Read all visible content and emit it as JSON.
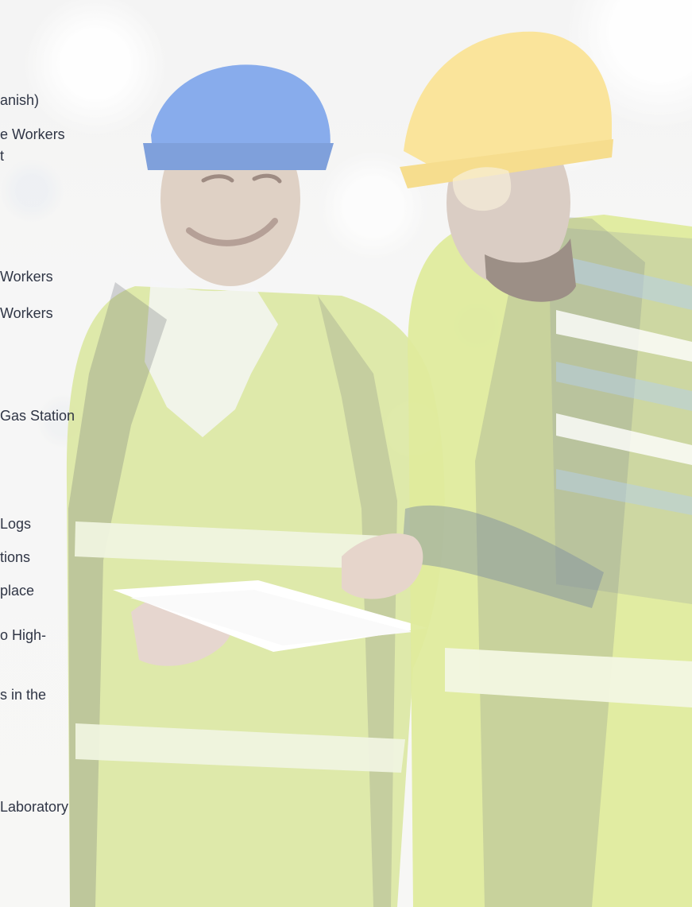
{
  "hero": {
    "image_name": "safety-workers-photo"
  },
  "course_fragments": [
    "anish)",
    "e Workers",
    "t",
    "Workers",
    "Workers",
    "Gas Station",
    "Logs",
    "tions",
    "place",
    "o High-",
    "s in the",
    "Laboratory"
  ]
}
